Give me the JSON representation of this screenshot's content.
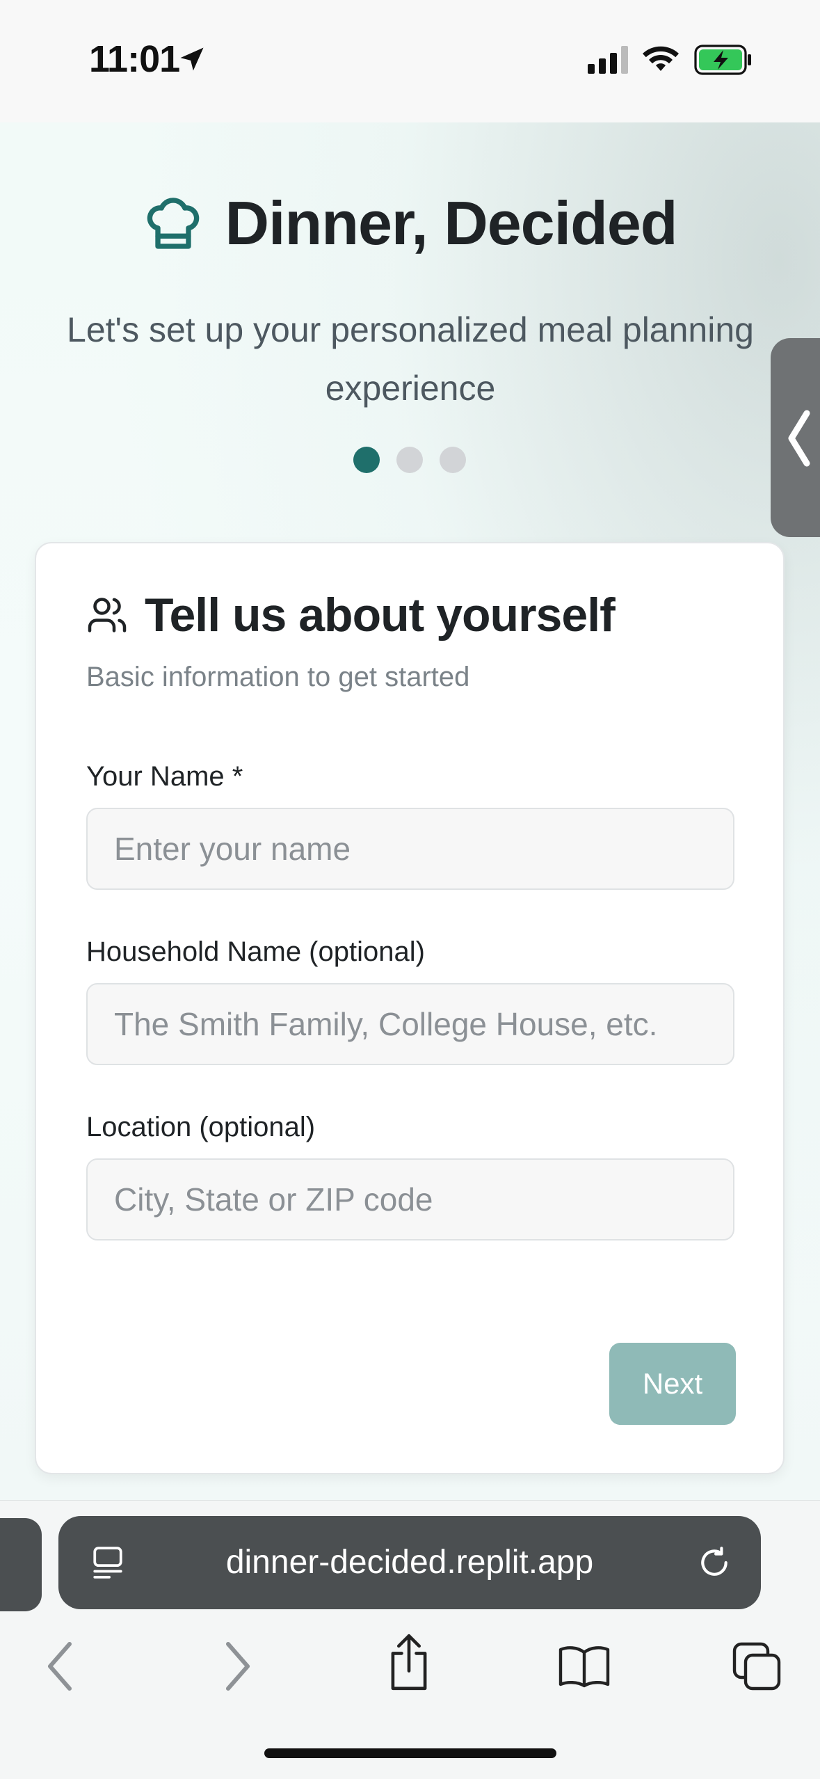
{
  "status_bar": {
    "time": "11:01"
  },
  "hero": {
    "title": "Dinner, Decided",
    "subtitle": "Let's set up your personalized meal planning experience",
    "steps": {
      "current": 1,
      "total": 3
    }
  },
  "card": {
    "title": "Tell us about yourself",
    "subtitle": "Basic information to get started",
    "fields": [
      {
        "label": "Your Name *",
        "placeholder": "Enter your name",
        "value": ""
      },
      {
        "label": "Household Name (optional)",
        "placeholder": "The Smith Family, College House, etc.",
        "value": ""
      },
      {
        "label": "Location (optional)",
        "placeholder": "City, State or ZIP code",
        "value": ""
      }
    ],
    "next_label": "Next"
  },
  "browser": {
    "url": "dinner-decided.replit.app"
  },
  "colors": {
    "accent": "#1f6f6b",
    "button_disabled": "#8fbab7",
    "battery": "#34c759"
  }
}
